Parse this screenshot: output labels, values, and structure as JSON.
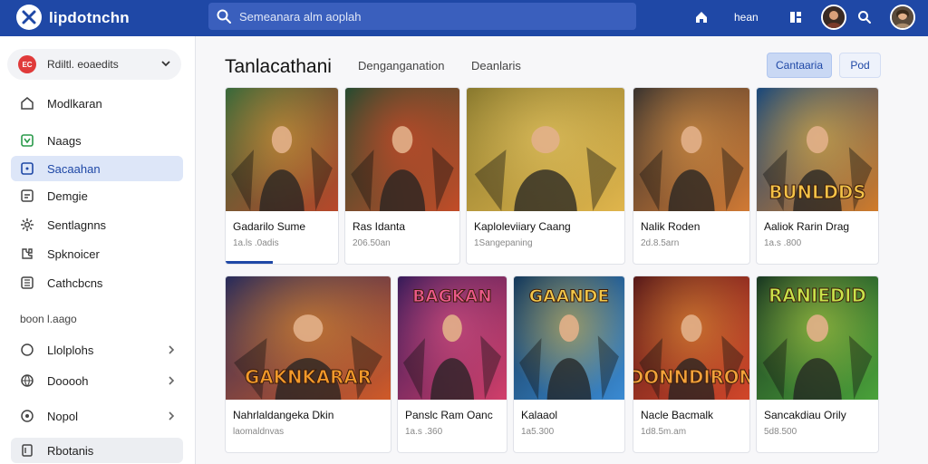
{
  "app": {
    "title": "lipdotnchn",
    "logo_icon": "logo-icon"
  },
  "search": {
    "placeholder": "Semeanara alm aoplah"
  },
  "topbar": {
    "link_label": "hean",
    "icons": [
      "home-icon",
      "grid-icon",
      "search-icon"
    ]
  },
  "sidebar": {
    "account_label": "Rdiltl. eoaedits",
    "account_badge": "EC",
    "items": [
      {
        "label": "Modlkaran",
        "icon": "home-icon"
      },
      {
        "label": "Naags",
        "icon": "news-icon"
      },
      {
        "label": "Sacaahan",
        "icon": "library-icon",
        "active": true
      },
      {
        "label": "Demgie",
        "icon": "document-icon"
      },
      {
        "label": "Sentlagnns",
        "icon": "settings-icon"
      },
      {
        "label": "Spknoicer",
        "icon": "puzzle-icon"
      },
      {
        "label": "Cathcbcns",
        "icon": "collection-icon"
      }
    ],
    "section_label": "boon l.aago",
    "section_items": [
      {
        "label": "Llolplohs",
        "icon": "circle-icon"
      },
      {
        "label": "Dooooh",
        "icon": "globe-icon"
      },
      {
        "label": "Nopol",
        "icon": "shield-icon"
      },
      {
        "label": "Rbotanis",
        "icon": "book-icon"
      }
    ]
  },
  "main": {
    "title": "Tanlacathani",
    "tabs": [
      "Denganganation",
      "Deanlaris"
    ],
    "primary_button": "Cantaaria",
    "secondary_button": "Pod"
  },
  "cards": [
    {
      "title": "Gadarilo Sume",
      "meta": "1a.ls .0adis",
      "colors": [
        "#3b6a3a",
        "#b8472a"
      ],
      "accent": "#e8a23a",
      "progress": 0.42
    },
    {
      "title": "Ras Idanta",
      "meta": "206.50an",
      "colors": [
        "#2a4b30",
        "#c34c28"
      ],
      "accent": "#e94a27"
    },
    {
      "title": "Kaploleviiary Caang",
      "meta": "1Sangepaning",
      "colors": [
        "#8a7a2f",
        "#e0b54c"
      ],
      "accent": "#f1d06a"
    },
    {
      "title": "Nalik Roden",
      "meta": "2d.8.5arn",
      "colors": [
        "#3c3530",
        "#d17a34"
      ],
      "accent": "#f0a44b"
    },
    {
      "title": "Aaliok Rarin Drag",
      "meta": "1a.s .800",
      "colors": [
        "#1d4a7a",
        "#d07b2a"
      ],
      "accent": "#f3c247",
      "banner": "BUNLDDS"
    },
    {
      "title": "Nahrlaldangeka Dkin",
      "meta": "laomaldnvas",
      "colors": [
        "#2b2d5a",
        "#d05a28"
      ],
      "accent": "#f39a2a",
      "banner": "GAKNKARAR"
    },
    {
      "title": "Panslc Ram Oanc",
      "meta": "1a.s .360",
      "colors": [
        "#3a1c5a",
        "#d23f6a"
      ],
      "accent": "#ec5a8a",
      "banner": "BAGKAN"
    },
    {
      "title": "Kalaaol",
      "meta": "1a5.300",
      "colors": [
        "#173a5a",
        "#3a8ad2"
      ],
      "accent": "#f2c84a",
      "banner": "GAANDE"
    },
    {
      "title": "Nacle Bacmalk",
      "meta": "1d8.5m.am",
      "colors": [
        "#5a1c1a",
        "#d2472a"
      ],
      "accent": "#f3a23a",
      "banner": "DONNDIRON"
    },
    {
      "title": "Sancakdiau Orily",
      "meta": "5d8.500",
      "colors": [
        "#1c3a22",
        "#4aa23a"
      ],
      "accent": "#c9e24a",
      "banner": "RANIEDID"
    }
  ]
}
